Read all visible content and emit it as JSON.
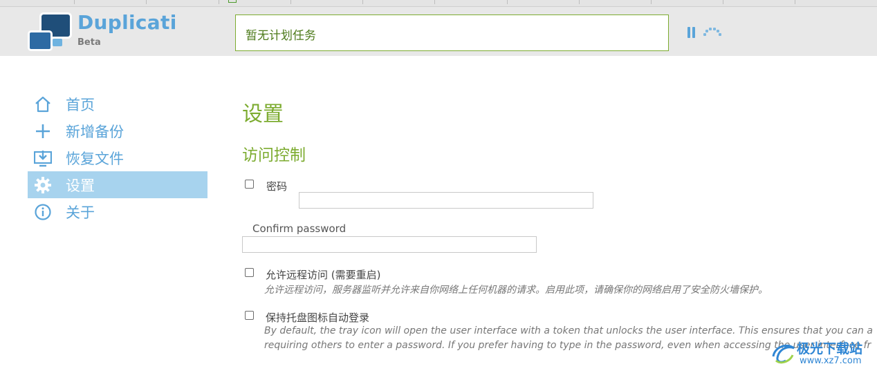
{
  "header": {
    "app_name": "Duplicati",
    "app_subtitle": "Beta",
    "status_text": "暂无计划任务"
  },
  "sidebar": {
    "items": [
      {
        "label": "首页",
        "icon": "home-icon"
      },
      {
        "label": "新增备份",
        "icon": "plus-icon"
      },
      {
        "label": "恢复文件",
        "icon": "restore-icon"
      },
      {
        "label": "设置",
        "icon": "gear-icon",
        "active": true
      },
      {
        "label": "关于",
        "icon": "info-icon"
      }
    ]
  },
  "main": {
    "title": "设置",
    "section_title": "访问控制",
    "password_label": "密码",
    "password_value": "",
    "confirm_label": "Confirm password",
    "confirm_value": "",
    "remote_label": "允许远程访问 (需要重启)",
    "remote_hint": "允许远程访问，服务器监听并允许来自你网络上任何机器的请求。启用此项，请确保你的网络启用了安全防火墙保护。",
    "tray_label": "保持托盘图标自动登录",
    "tray_hint_1": "By default, the tray icon will open the user interface with a token that unlocks the user interface. This ensures that you can a",
    "tray_hint_2": "requiring others to enter a password. If you prefer having to type in the password, even when accessing the user interface fr"
  },
  "watermark": {
    "line1": "极光下载站",
    "line2": "www.xz7.com"
  },
  "colors": {
    "accent_blue": "#5aa4d9",
    "accent_green": "#7cab2f",
    "active_nav": "#a7d3ee"
  }
}
